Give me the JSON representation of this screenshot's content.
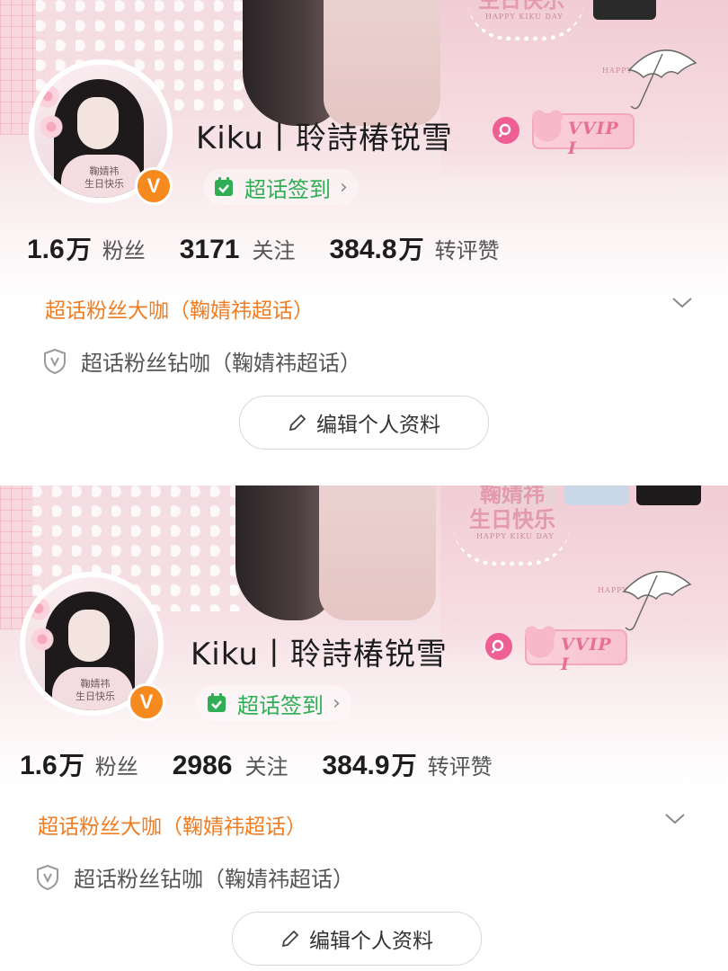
{
  "profiles": [
    {
      "banner": {
        "text_cn": "生日快乐",
        "text_en": "HAPPY KIKU DAY",
        "text_corner": "HAPPY"
      },
      "avatar": {
        "text_line1": "鞠婧祎",
        "text_line2": "生日快乐"
      },
      "verified_mark": "V",
      "name": "Kiku丨聆詩椿锐雪",
      "vip_label": "VVIP I",
      "checkin": {
        "label": "超话签到",
        "chevron": "›"
      },
      "stats": [
        {
          "num": "1.6",
          "unit": "万",
          "label": "粉丝"
        },
        {
          "num": "3171",
          "unit": "",
          "label": "关注"
        },
        {
          "num": "384.8",
          "unit": "万",
          "label": "转评赞"
        }
      ],
      "badge_title": "超话粉丝大咖（鞠婧祎超话）",
      "sub_badge": "超话粉丝钻咖（鞠婧祎超话）",
      "edit_button": "编辑个人资料"
    },
    {
      "banner": {
        "text_cn": "鞠婧祎\n生日快乐",
        "text_en": "HAPPY KIKU DAY",
        "text_corner": "HAPPY B"
      },
      "avatar": {
        "text_line1": "鞠婧祎",
        "text_line2": "生日快乐"
      },
      "verified_mark": "V",
      "name": "Kiku丨聆詩椿锐雪",
      "vip_label": "VVIP I",
      "checkin": {
        "label": "超话签到",
        "chevron": "›"
      },
      "stats": [
        {
          "num": "1.6",
          "unit": "万",
          "label": "粉丝"
        },
        {
          "num": "2986",
          "unit": "",
          "label": "关注"
        },
        {
          "num": "384.9",
          "unit": "万",
          "label": "转评赞"
        }
      ],
      "badge_title": "超话粉丝大咖（鞠婧祎超话）",
      "sub_badge": "超话粉丝钻咖（鞠婧祎超话）",
      "edit_button": "编辑个人资料"
    }
  ],
  "colors": {
    "checkin_green": "#2fae55",
    "badge_orange": "#f07d23",
    "verified_orange": "#f78a1f",
    "search_pink": "#ee5f93",
    "vip_pink": "#e5708f"
  },
  "icons": [
    "calendar-check-icon",
    "chevron-right-icon",
    "chevron-down-icon",
    "shield-v-icon",
    "pencil-icon",
    "search-icon",
    "verified-v-icon",
    "umbrella-icon",
    "bear-icon"
  ]
}
